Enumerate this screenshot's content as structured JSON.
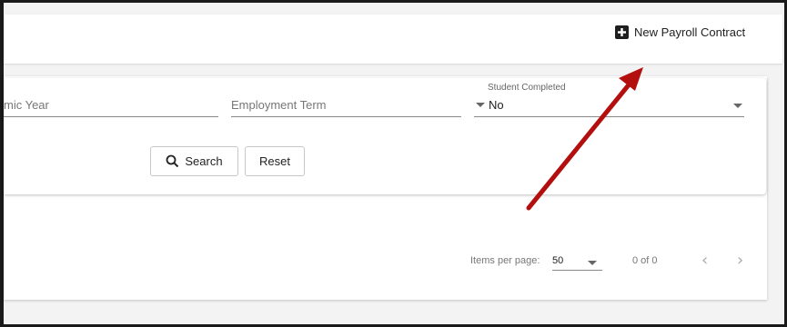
{
  "header": {
    "new_button_label": "New Payroll Contract"
  },
  "filters": {
    "academic_year_label": "mic Year",
    "employment_term_label": "Employment Term",
    "student_completed": {
      "label": "Student Completed",
      "value": "No"
    }
  },
  "actions": {
    "search_label": "Search",
    "reset_label": "Reset"
  },
  "paginator": {
    "items_per_page_label": "Items per page:",
    "items_per_page_value": "50",
    "range_label": "0 of 0"
  },
  "colors": {
    "arrow": "#b30f0f",
    "page_background": "#f3f3f3"
  },
  "icons": {
    "new": "plus-box-icon",
    "search": "search-icon",
    "prev": "chevron-left-icon",
    "next": "chevron-right-icon"
  }
}
